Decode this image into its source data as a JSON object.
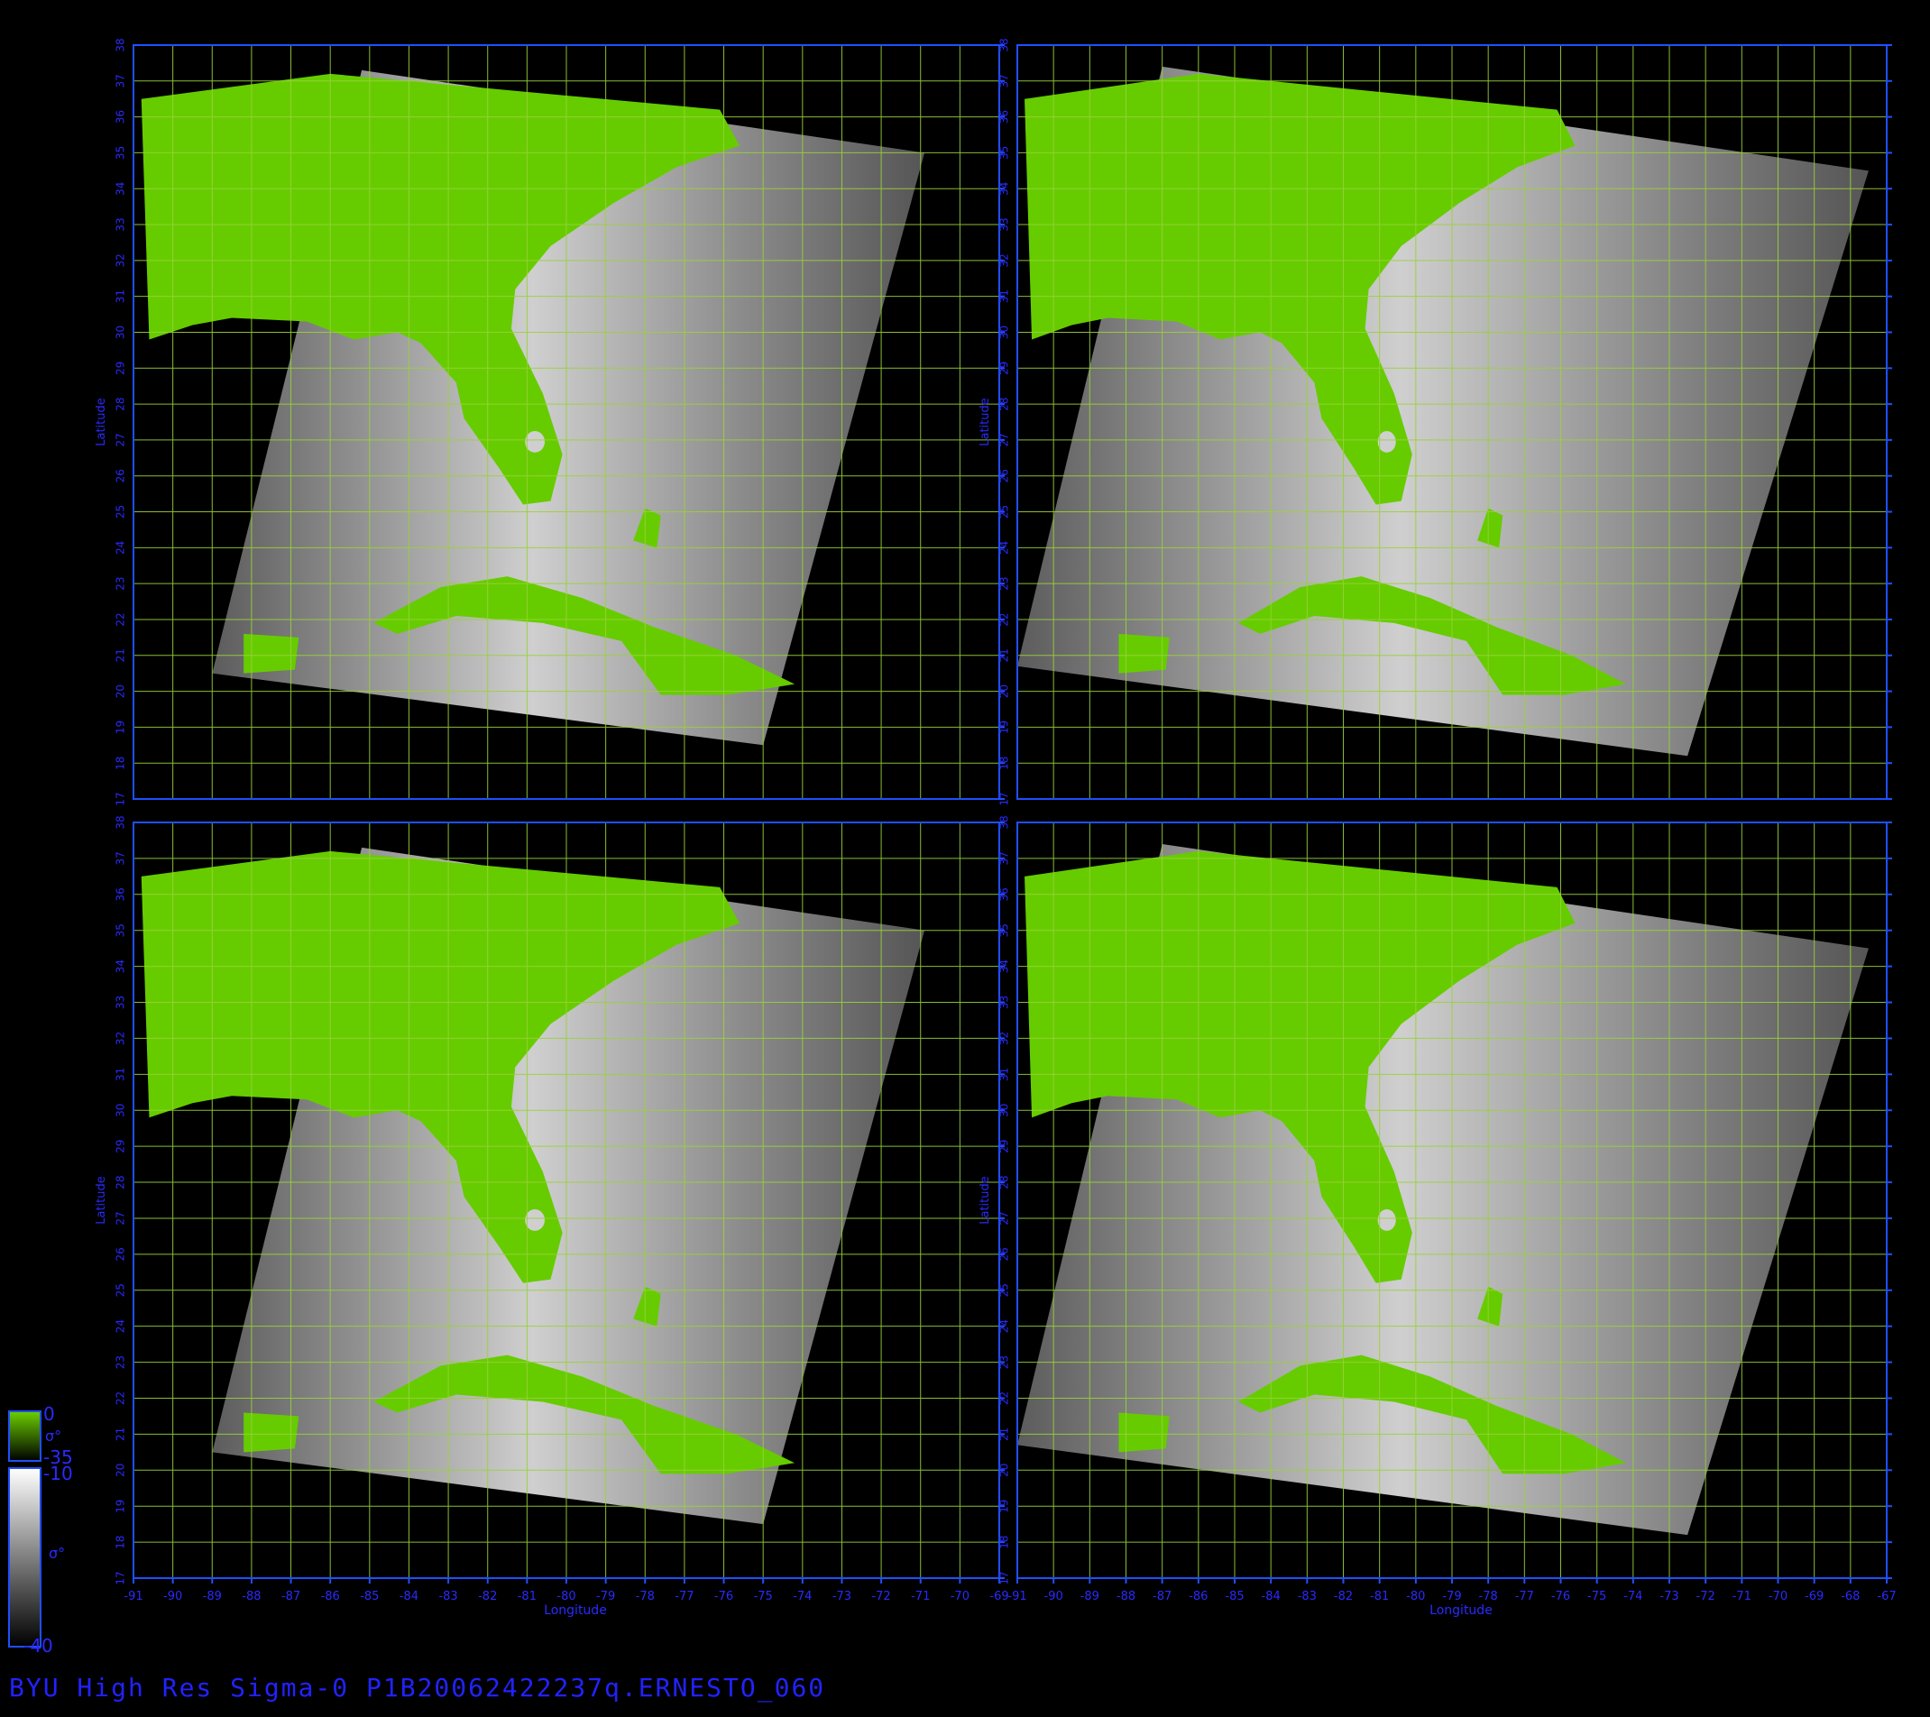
{
  "title": "BYU High Res Sigma-0 P1B20062422237q.ERNESTO_060",
  "colors": {
    "frame": "#1f4fff",
    "label": "#2a2aff",
    "grid": "#9ad13a",
    "land": "#66cc00",
    "background": "#000000"
  },
  "axes": {
    "left": {
      "lon_min": -91,
      "lon_max": -69,
      "lon_step": 1
    },
    "right": {
      "lon_min": -91,
      "lon_max": -67,
      "lon_step": 1
    },
    "lat_min": 17,
    "lat_max": 38,
    "lat_step": 1,
    "xlabel": "Longitude",
    "ylabel": "Latitude",
    "x_ticks_left": [
      "-91",
      "-90",
      "-89",
      "-88",
      "-87",
      "-86",
      "-85",
      "-84",
      "-83",
      "-82",
      "-81",
      "-80",
      "-79",
      "-78",
      "-77",
      "-76",
      "-75",
      "-74",
      "-73",
      "-72",
      "-71",
      "-70",
      "-69"
    ],
    "x_ticks_right": [
      "-91",
      "-90",
      "-89",
      "-88",
      "-87",
      "-86",
      "-85",
      "-84",
      "-83",
      "-82",
      "-81",
      "-80",
      "-79",
      "-78",
      "-77",
      "-76",
      "-75",
      "-74",
      "-73",
      "-72",
      "-71",
      "-70",
      "-69",
      "-68",
      "-67"
    ],
    "y_ticks": [
      "17",
      "18",
      "19",
      "20",
      "21",
      "22",
      "23",
      "24",
      "25",
      "26",
      "27",
      "28",
      "29",
      "30",
      "31",
      "32",
      "33",
      "34",
      "35",
      "36",
      "37",
      "38"
    ]
  },
  "panels": [
    {
      "id": "top-left",
      "col": 0,
      "row": 0
    },
    {
      "id": "top-right",
      "col": 1,
      "row": 0
    },
    {
      "id": "bottom-left",
      "col": 0,
      "row": 1
    },
    {
      "id": "bottom-right",
      "col": 1,
      "row": 1
    }
  ],
  "colorbar": {
    "land_max": "0",
    "land_symbol": "σ°",
    "land_min": "-35",
    "ocean_max": "-10",
    "ocean_symbol": "σ°",
    "ocean_min": "-40"
  },
  "chart_data": {
    "type": "heatmap",
    "description": "",
    "panels": 4,
    "xlabel": "Longitude",
    "ylabel": "Latitude",
    "lat_range": [
      17,
      38
    ],
    "lon_range_left": [
      -91,
      -69
    ],
    "lon_range_right": [
      -91,
      -67
    ],
    "colorbar_land": [
      -35,
      0
    ],
    "colorbar_ocean": [
      -40,
      -10
    ]
  }
}
